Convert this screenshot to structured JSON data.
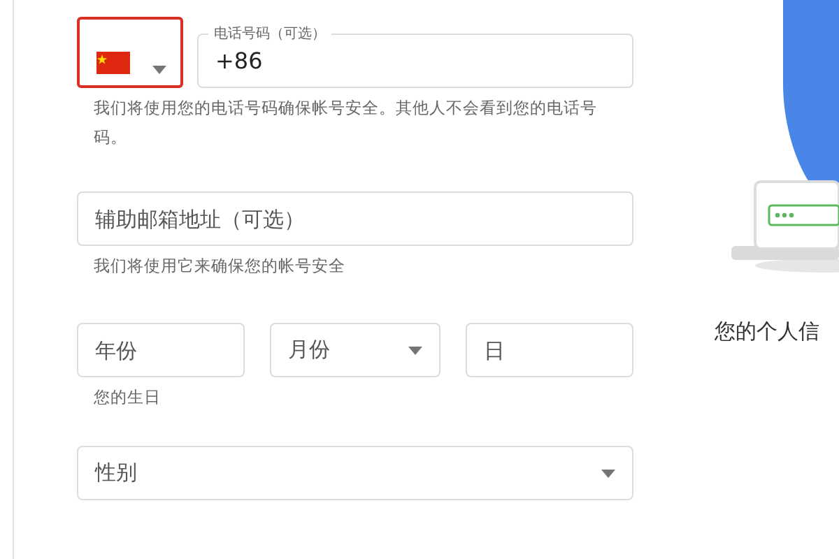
{
  "phone": {
    "country_selector": {
      "highlighted": true
    },
    "label": "电话号码（可选）",
    "value": "+86",
    "hint": "我们将使用您的电话号码确保帐号安全。其他人不会看到您的电话号码。"
  },
  "recovery_email": {
    "placeholder": "辅助邮箱地址（可选）",
    "hint": "我们将使用它来确保您的帐号安全"
  },
  "birthday": {
    "fields": [
      {
        "kind": "input",
        "placeholder": "年份"
      },
      {
        "kind": "select",
        "placeholder": "月份"
      },
      {
        "kind": "input",
        "placeholder": "日"
      }
    ],
    "hint": "您的生日"
  },
  "gender": {
    "placeholder": "性别"
  },
  "side_panel": {
    "caption": "您的个人信"
  }
}
